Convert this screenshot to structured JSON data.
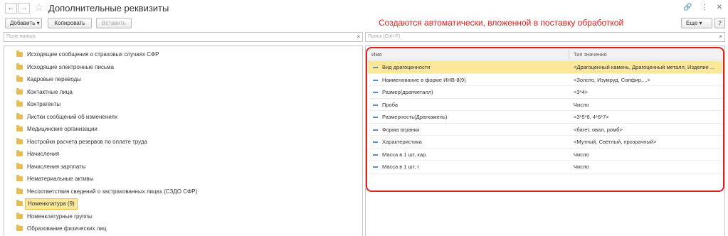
{
  "window": {
    "title": "Дополнительные реквизиты",
    "back_glyph": "←",
    "forward_glyph": "→",
    "star_glyph": "☆",
    "link_glyph": "🔗",
    "menu_glyph": "⋮",
    "close_glyph": "✕"
  },
  "toolbar": {
    "add_label": "Добавить ▾",
    "copy_label": "Копировать",
    "paste_label": "Вставить",
    "more_label": "Еще ▾",
    "help_label": "?"
  },
  "annotation": {
    "text": "Создаются автоматически, вложенной в поставку обработкой",
    "color": "#e0201a"
  },
  "left_search": {
    "placeholder": "Поле поиска",
    "clear": "×"
  },
  "right_search": {
    "placeholder": "Поиск (Ctrl+F)",
    "clear": "×"
  },
  "tree": {
    "items": [
      {
        "label": "Исходящие сообщения о страховых случаях СФР"
      },
      {
        "label": "Исходящие электронные письма"
      },
      {
        "label": "Кадровые переводы"
      },
      {
        "label": "Контактные лица"
      },
      {
        "label": "Контрагенты"
      },
      {
        "label": "Листки сообщений об изменениях"
      },
      {
        "label": "Медицинские организации"
      },
      {
        "label": "Настройки расчета резервов по оплате труда"
      },
      {
        "label": "Начисления"
      },
      {
        "label": "Начисления зарплаты"
      },
      {
        "label": "Нематериальные активы"
      },
      {
        "label": "Несоответствия сведений о застрахованных лицах (СЗДО СФР)"
      },
      {
        "label": "Номенклатура (9)",
        "selected": true
      },
      {
        "label": "Номенклатурные группы"
      },
      {
        "label": "Образование физических лиц"
      }
    ]
  },
  "grid": {
    "headers": {
      "name": "Имя",
      "type": "Тип значения"
    },
    "rows": [
      {
        "name": "Вид драгоценности",
        "type": "<Драгоценный камень, Драгоценный металл, Изделие ...",
        "selected": true
      },
      {
        "name": "Наименование в форме ИНВ-8(9)",
        "type": "<Золото, Изумруд, Сапфир,...>"
      },
      {
        "name": "Размер(драгметалл)",
        "type": "<3*4>"
      },
      {
        "name": "Проба",
        "type": "Число"
      },
      {
        "name": "Размерность(Драгкамень)",
        "type": "<3*5*6, 4*6*7>"
      },
      {
        "name": "Форма огранки",
        "type": "<багет, овал, ромб>"
      },
      {
        "name": "Характеристика",
        "type": "<Мутный, Светлый, прозрачный>"
      },
      {
        "name": "Масса в 1 шт, кар",
        "type": "Число"
      },
      {
        "name": "Масса в 1 шт, г",
        "type": "Число"
      }
    ]
  },
  "colors": {
    "selection": "#fbe89a",
    "folder": "#e8bb55",
    "frame": "#e0201a"
  }
}
